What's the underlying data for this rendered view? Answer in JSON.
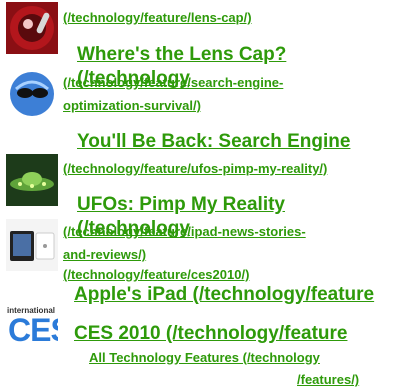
{
  "features": [
    {
      "url_text": "(/technology/feature/lens-cap/)",
      "title": "Where's the Lens Cap? (/technology",
      "icon": "lens-cap-thumbnail"
    },
    {
      "url_text_1": "(/technology/feature/search-engine-",
      "url_text_2": "optimization-survival/)",
      "title": "You'll Be Back: Search Engine",
      "icon": "search-engine-thumbnail"
    },
    {
      "url_text": "(/technology/feature/ufos-pimp-my-reality/)",
      "title": "UFOs: Pimp My Reality (/technology",
      "icon": "ufo-thumbnail"
    },
    {
      "url_text_1": "(/technology/feature/ipad-news-stories-",
      "url_text_2": "and-reviews/)",
      "title": "Apple's iPad (/technology/feature",
      "icon": "ipad-thumbnail"
    },
    {
      "url_text": "(/technology/feature/ces2010/)",
      "title": "CES 2010 (/technology/feature",
      "icon": "ces-thumbnail"
    }
  ],
  "all_features": {
    "line1": "All Technology Features (/technology",
    "line2": "/features/)"
  },
  "ces_logo_text": {
    "top": "international",
    "big": "CES"
  },
  "colors": {
    "link": "#2e9a0a",
    "background": "#ffffff"
  }
}
